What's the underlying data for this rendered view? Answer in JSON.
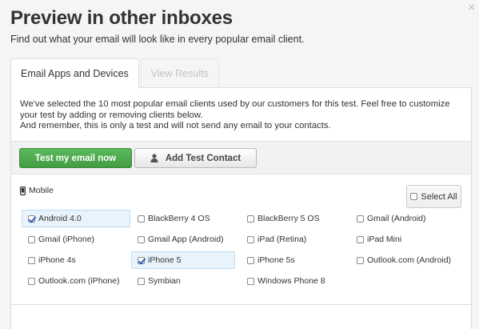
{
  "dialog": {
    "close_label": "×",
    "title": "Preview in other inboxes",
    "subtitle": "Find out what your email will look like in every popular email client."
  },
  "tabs": [
    {
      "label": "Email Apps and Devices",
      "active": true
    },
    {
      "label": "View Results",
      "active": false
    }
  ],
  "intro": {
    "line1": "We've selected the 10 most popular email clients used by our customers for this test. Feel free to customize your test by adding or removing clients below.",
    "line2": "And remember, this is only a test and will not send any email to your contacts."
  },
  "actions": {
    "test_label": "Test my email now",
    "add_contact_label": "Add Test Contact",
    "add_contact_icon": "person-icon",
    "primary_color": "#4cae4c"
  },
  "section": {
    "label": "Mobile",
    "icon": "mobile-phone-icon",
    "select_all_label": "Select All"
  },
  "clients": [
    {
      "label": "Android 4.0",
      "checked": true
    },
    {
      "label": "BlackBerry 4 OS",
      "checked": false
    },
    {
      "label": "BlackBerry 5 OS",
      "checked": false
    },
    {
      "label": "Gmail (Android)",
      "checked": false
    },
    {
      "label": "Gmail (iPhone)",
      "checked": false
    },
    {
      "label": "Gmail App (Android)",
      "checked": false
    },
    {
      "label": "iPad (Retina)",
      "checked": false
    },
    {
      "label": "iPad Mini",
      "checked": false
    },
    {
      "label": "iPhone 4s",
      "checked": false
    },
    {
      "label": "iPhone 5",
      "checked": true
    },
    {
      "label": "iPhone 5s",
      "checked": false
    },
    {
      "label": "Outlook.com (Android)",
      "checked": false
    },
    {
      "label": "Outlook.com (iPhone)",
      "checked": false
    },
    {
      "label": "Symbian",
      "checked": false
    },
    {
      "label": "Windows Phone 8",
      "checked": false
    }
  ]
}
